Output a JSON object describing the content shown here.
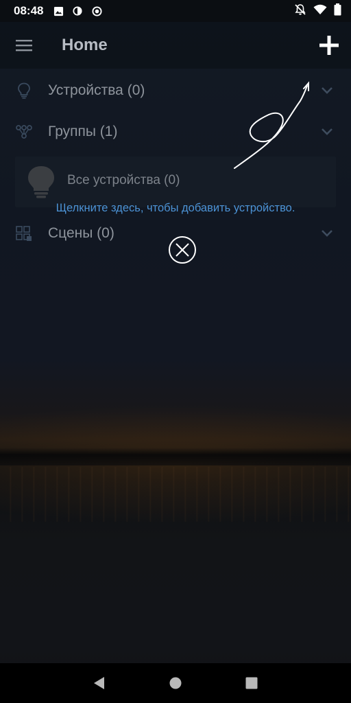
{
  "status_bar": {
    "time": "08:48",
    "icons_left": [
      "image-icon",
      "contrast-icon",
      "record-icon"
    ],
    "icons_right": [
      "notifications-off-icon",
      "wifi-icon",
      "battery-icon"
    ]
  },
  "app_bar": {
    "title": "Home",
    "menu_icon": "hamburger-menu-icon",
    "add_icon": "plus-icon"
  },
  "sections": {
    "devices": {
      "label": "Устройства (0)",
      "icon": "lightbulb-icon"
    },
    "groups": {
      "label": "Группы (1)",
      "icon": "group-nodes-icon"
    },
    "scenes": {
      "label": "Сцены (0)",
      "icon": "scenes-grid-icon"
    }
  },
  "group_item": {
    "name": "Все устройства (0)",
    "icon": "lightbulb-icon"
  },
  "hint_text": "Щелкните здесь, чтобы добавить устройство.",
  "nav": {
    "back": "back-triangle-icon",
    "home": "home-circle-icon",
    "recents": "recents-square-icon"
  },
  "colors": {
    "accent_link": "#4c93d6",
    "muted_text": "#8e949c"
  }
}
